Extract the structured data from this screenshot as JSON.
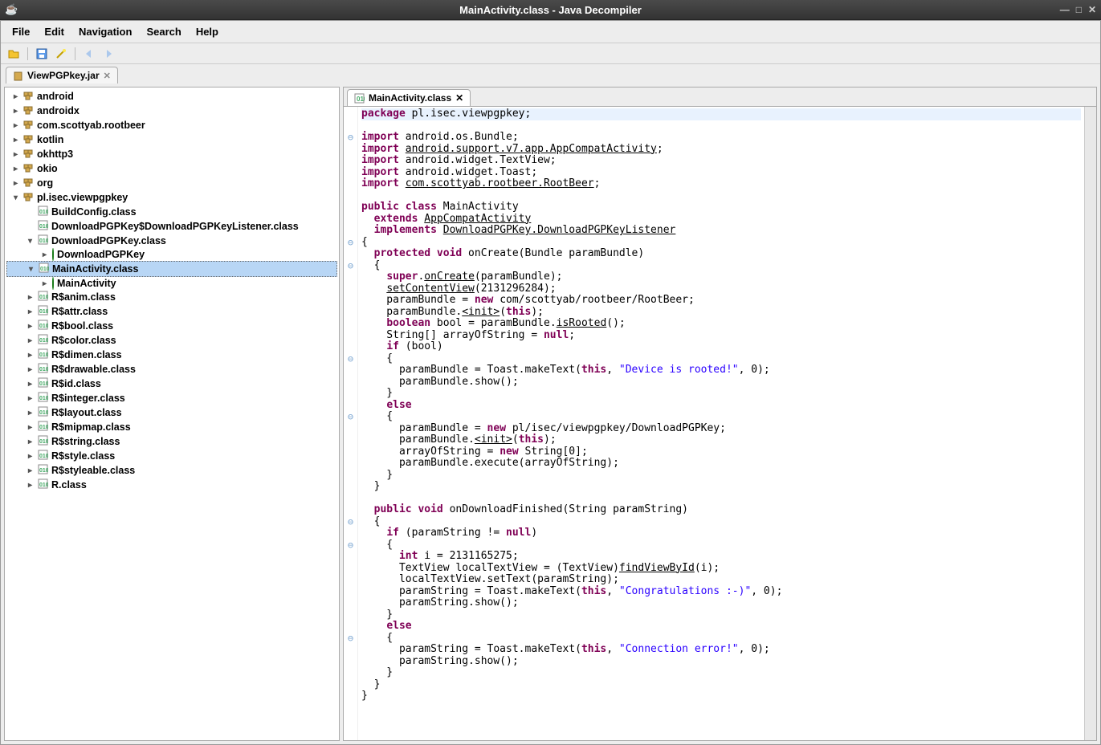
{
  "window": {
    "title": "MainActivity.class - Java Decompiler"
  },
  "menu": [
    "File",
    "Edit",
    "Navigation",
    "Search",
    "Help"
  ],
  "toolbar_icons": [
    "open-icon",
    "save-icon",
    "wand-icon",
    "back-icon",
    "forward-icon"
  ],
  "main_tab": {
    "label": "ViewPGPkey.jar"
  },
  "tree": [
    {
      "ind": 0,
      "toggle": "▸",
      "kind": "pkg",
      "label": "android"
    },
    {
      "ind": 0,
      "toggle": "▸",
      "kind": "pkg",
      "label": "androidx"
    },
    {
      "ind": 0,
      "toggle": "▸",
      "kind": "pkg",
      "label": "com.scottyab.rootbeer"
    },
    {
      "ind": 0,
      "toggle": "▸",
      "kind": "pkg",
      "label": "kotlin"
    },
    {
      "ind": 0,
      "toggle": "▸",
      "kind": "pkg",
      "label": "okhttp3"
    },
    {
      "ind": 0,
      "toggle": "▸",
      "kind": "pkg",
      "label": "okio"
    },
    {
      "ind": 0,
      "toggle": "▸",
      "kind": "pkg",
      "label": "org"
    },
    {
      "ind": 0,
      "toggle": "▾",
      "kind": "pkg",
      "label": "pl.isec.viewpgpkey"
    },
    {
      "ind": 1,
      "toggle": "",
      "kind": "cls",
      "label": "BuildConfig.class"
    },
    {
      "ind": 1,
      "toggle": "",
      "kind": "cls",
      "label": "DownloadPGPKey$DownloadPGPKeyListener.class"
    },
    {
      "ind": 1,
      "toggle": "▾",
      "kind": "cls",
      "label": "DownloadPGPKey.class"
    },
    {
      "ind": 2,
      "toggle": "▸",
      "kind": "mth",
      "label": "DownloadPGPKey"
    },
    {
      "ind": 1,
      "toggle": "▾",
      "kind": "cls",
      "label": "MainActivity.class",
      "selected": true
    },
    {
      "ind": 2,
      "toggle": "▸",
      "kind": "mth",
      "label": "MainActivity"
    },
    {
      "ind": 1,
      "toggle": "▸",
      "kind": "cls",
      "label": "R$anim.class"
    },
    {
      "ind": 1,
      "toggle": "▸",
      "kind": "cls",
      "label": "R$attr.class"
    },
    {
      "ind": 1,
      "toggle": "▸",
      "kind": "cls",
      "label": "R$bool.class"
    },
    {
      "ind": 1,
      "toggle": "▸",
      "kind": "cls",
      "label": "R$color.class"
    },
    {
      "ind": 1,
      "toggle": "▸",
      "kind": "cls",
      "label": "R$dimen.class"
    },
    {
      "ind": 1,
      "toggle": "▸",
      "kind": "cls",
      "label": "R$drawable.class"
    },
    {
      "ind": 1,
      "toggle": "▸",
      "kind": "cls",
      "label": "R$id.class"
    },
    {
      "ind": 1,
      "toggle": "▸",
      "kind": "cls",
      "label": "R$integer.class"
    },
    {
      "ind": 1,
      "toggle": "▸",
      "kind": "cls",
      "label": "R$layout.class"
    },
    {
      "ind": 1,
      "toggle": "▸",
      "kind": "cls",
      "label": "R$mipmap.class"
    },
    {
      "ind": 1,
      "toggle": "▸",
      "kind": "cls",
      "label": "R$string.class"
    },
    {
      "ind": 1,
      "toggle": "▸",
      "kind": "cls",
      "label": "R$style.class"
    },
    {
      "ind": 1,
      "toggle": "▸",
      "kind": "cls",
      "label": "R$styleable.class"
    },
    {
      "ind": 1,
      "toggle": "▸",
      "kind": "cls",
      "label": "R.class"
    }
  ],
  "editor_tab": {
    "label": "MainActivity.class"
  },
  "code_lines": [
    {
      "fold": "",
      "hl": true,
      "tokens": [
        {
          "t": "kw",
          "v": "package"
        },
        {
          "t": "",
          "v": " pl.isec.viewpgpkey;"
        }
      ]
    },
    {
      "fold": "",
      "tokens": [
        {
          "t": "",
          "v": ""
        }
      ]
    },
    {
      "fold": "⊖",
      "tokens": [
        {
          "t": "kw",
          "v": "import"
        },
        {
          "t": "",
          "v": " android.os.Bundle;"
        }
      ]
    },
    {
      "fold": "",
      "tokens": [
        {
          "t": "kw",
          "v": "import"
        },
        {
          "t": "",
          "v": " "
        },
        {
          "t": "lnk",
          "v": "android.support.v7.app.AppCompatActivity"
        },
        {
          "t": "",
          "v": ";"
        }
      ]
    },
    {
      "fold": "",
      "tokens": [
        {
          "t": "kw",
          "v": "import"
        },
        {
          "t": "",
          "v": " android.widget.TextView;"
        }
      ]
    },
    {
      "fold": "",
      "tokens": [
        {
          "t": "kw",
          "v": "import"
        },
        {
          "t": "",
          "v": " android.widget.Toast;"
        }
      ]
    },
    {
      "fold": "",
      "tokens": [
        {
          "t": "kw",
          "v": "import"
        },
        {
          "t": "",
          "v": " "
        },
        {
          "t": "lnk",
          "v": "com.scottyab.rootbeer.RootBeer"
        },
        {
          "t": "",
          "v": ";"
        }
      ]
    },
    {
      "fold": "",
      "tokens": [
        {
          "t": "",
          "v": ""
        }
      ]
    },
    {
      "fold": "",
      "tokens": [
        {
          "t": "kw",
          "v": "public class"
        },
        {
          "t": "",
          "v": " MainActivity"
        }
      ]
    },
    {
      "fold": "",
      "tokens": [
        {
          "t": "",
          "v": "  "
        },
        {
          "t": "kw",
          "v": "extends"
        },
        {
          "t": "",
          "v": " "
        },
        {
          "t": "lnk",
          "v": "AppCompatActivity"
        }
      ]
    },
    {
      "fold": "",
      "tokens": [
        {
          "t": "",
          "v": "  "
        },
        {
          "t": "kw",
          "v": "implements"
        },
        {
          "t": "",
          "v": " "
        },
        {
          "t": "lnk",
          "v": "DownloadPGPKey.DownloadPGPKeyListener"
        }
      ]
    },
    {
      "fold": "⊖",
      "tokens": [
        {
          "t": "",
          "v": "{"
        }
      ]
    },
    {
      "fold": "",
      "tokens": [
        {
          "t": "",
          "v": "  "
        },
        {
          "t": "kw",
          "v": "protected void"
        },
        {
          "t": "",
          "v": " onCreate(Bundle paramBundle)"
        }
      ]
    },
    {
      "fold": "⊖",
      "tokens": [
        {
          "t": "",
          "v": "  {"
        }
      ]
    },
    {
      "fold": "",
      "tokens": [
        {
          "t": "",
          "v": "    "
        },
        {
          "t": "kw",
          "v": "super"
        },
        {
          "t": "",
          "v": "."
        },
        {
          "t": "lnk",
          "v": "onCreate"
        },
        {
          "t": "",
          "v": "(paramBundle);"
        }
      ]
    },
    {
      "fold": "",
      "tokens": [
        {
          "t": "",
          "v": "    "
        },
        {
          "t": "lnk",
          "v": "setContentView"
        },
        {
          "t": "",
          "v": "(2131296284);"
        }
      ]
    },
    {
      "fold": "",
      "tokens": [
        {
          "t": "",
          "v": "    paramBundle = "
        },
        {
          "t": "kw",
          "v": "new"
        },
        {
          "t": "",
          "v": " com/scottyab/rootbeer/RootBeer;"
        }
      ]
    },
    {
      "fold": "",
      "tokens": [
        {
          "t": "",
          "v": "    paramBundle."
        },
        {
          "t": "lnk",
          "v": "<init>"
        },
        {
          "t": "",
          "v": "("
        },
        {
          "t": "kw",
          "v": "this"
        },
        {
          "t": "",
          "v": ");"
        }
      ]
    },
    {
      "fold": "",
      "tokens": [
        {
          "t": "",
          "v": "    "
        },
        {
          "t": "kw",
          "v": "boolean"
        },
        {
          "t": "",
          "v": " bool = paramBundle."
        },
        {
          "t": "lnk",
          "v": "isRooted"
        },
        {
          "t": "",
          "v": "();"
        }
      ]
    },
    {
      "fold": "",
      "tokens": [
        {
          "t": "",
          "v": "    String[] arrayOfString = "
        },
        {
          "t": "kw",
          "v": "null"
        },
        {
          "t": "",
          "v": ";"
        }
      ]
    },
    {
      "fold": "",
      "tokens": [
        {
          "t": "",
          "v": "    "
        },
        {
          "t": "kw",
          "v": "if"
        },
        {
          "t": "",
          "v": " (bool)"
        }
      ]
    },
    {
      "fold": "⊖",
      "tokens": [
        {
          "t": "",
          "v": "    {"
        }
      ]
    },
    {
      "fold": "",
      "tokens": [
        {
          "t": "",
          "v": "      paramBundle = Toast.makeText("
        },
        {
          "t": "kw",
          "v": "this"
        },
        {
          "t": "",
          "v": ", "
        },
        {
          "t": "str",
          "v": "\"Device is rooted!\""
        },
        {
          "t": "",
          "v": ", 0);"
        }
      ]
    },
    {
      "fold": "",
      "tokens": [
        {
          "t": "",
          "v": "      paramBundle.show();"
        }
      ]
    },
    {
      "fold": "",
      "tokens": [
        {
          "t": "",
          "v": "    }"
        }
      ]
    },
    {
      "fold": "",
      "tokens": [
        {
          "t": "",
          "v": "    "
        },
        {
          "t": "kw",
          "v": "else"
        }
      ]
    },
    {
      "fold": "⊖",
      "tokens": [
        {
          "t": "",
          "v": "    {"
        }
      ]
    },
    {
      "fold": "",
      "tokens": [
        {
          "t": "",
          "v": "      paramBundle = "
        },
        {
          "t": "kw",
          "v": "new"
        },
        {
          "t": "",
          "v": " pl/isec/viewpgpkey/DownloadPGPKey;"
        }
      ]
    },
    {
      "fold": "",
      "tokens": [
        {
          "t": "",
          "v": "      paramBundle."
        },
        {
          "t": "lnk",
          "v": "<init>"
        },
        {
          "t": "",
          "v": "("
        },
        {
          "t": "kw",
          "v": "this"
        },
        {
          "t": "",
          "v": ");"
        }
      ]
    },
    {
      "fold": "",
      "tokens": [
        {
          "t": "",
          "v": "      arrayOfString = "
        },
        {
          "t": "kw",
          "v": "new"
        },
        {
          "t": "",
          "v": " String[0];"
        }
      ]
    },
    {
      "fold": "",
      "tokens": [
        {
          "t": "",
          "v": "      paramBundle.execute(arrayOfString);"
        }
      ]
    },
    {
      "fold": "",
      "tokens": [
        {
          "t": "",
          "v": "    }"
        }
      ]
    },
    {
      "fold": "",
      "tokens": [
        {
          "t": "",
          "v": "  }"
        }
      ]
    },
    {
      "fold": "",
      "tokens": [
        {
          "t": "",
          "v": "  "
        }
      ]
    },
    {
      "fold": "",
      "tokens": [
        {
          "t": "",
          "v": "  "
        },
        {
          "t": "kw",
          "v": "public void"
        },
        {
          "t": "",
          "v": " onDownloadFinished(String paramString)"
        }
      ]
    },
    {
      "fold": "⊖",
      "tokens": [
        {
          "t": "",
          "v": "  {"
        }
      ]
    },
    {
      "fold": "",
      "tokens": [
        {
          "t": "",
          "v": "    "
        },
        {
          "t": "kw",
          "v": "if"
        },
        {
          "t": "",
          "v": " (paramString != "
        },
        {
          "t": "kw",
          "v": "null"
        },
        {
          "t": "",
          "v": ")"
        }
      ]
    },
    {
      "fold": "⊖",
      "tokens": [
        {
          "t": "",
          "v": "    {"
        }
      ]
    },
    {
      "fold": "",
      "tokens": [
        {
          "t": "",
          "v": "      "
        },
        {
          "t": "kw",
          "v": "int"
        },
        {
          "t": "",
          "v": " i = 2131165275;"
        }
      ]
    },
    {
      "fold": "",
      "tokens": [
        {
          "t": "",
          "v": "      TextView localTextView = (TextView)"
        },
        {
          "t": "lnk",
          "v": "findViewById"
        },
        {
          "t": "",
          "v": "(i);"
        }
      ]
    },
    {
      "fold": "",
      "tokens": [
        {
          "t": "",
          "v": "      localTextView.setText(paramString);"
        }
      ]
    },
    {
      "fold": "",
      "tokens": [
        {
          "t": "",
          "v": "      paramString = Toast.makeText("
        },
        {
          "t": "kw",
          "v": "this"
        },
        {
          "t": "",
          "v": ", "
        },
        {
          "t": "str",
          "v": "\"Congratulations :-)\""
        },
        {
          "t": "",
          "v": ", 0);"
        }
      ]
    },
    {
      "fold": "",
      "tokens": [
        {
          "t": "",
          "v": "      paramString.show();"
        }
      ]
    },
    {
      "fold": "",
      "tokens": [
        {
          "t": "",
          "v": "    }"
        }
      ]
    },
    {
      "fold": "",
      "tokens": [
        {
          "t": "",
          "v": "    "
        },
        {
          "t": "kw",
          "v": "else"
        }
      ]
    },
    {
      "fold": "⊖",
      "tokens": [
        {
          "t": "",
          "v": "    {"
        }
      ]
    },
    {
      "fold": "",
      "tokens": [
        {
          "t": "",
          "v": "      paramString = Toast.makeText("
        },
        {
          "t": "kw",
          "v": "this"
        },
        {
          "t": "",
          "v": ", "
        },
        {
          "t": "str",
          "v": "\"Connection error!\""
        },
        {
          "t": "",
          "v": ", 0);"
        }
      ]
    },
    {
      "fold": "",
      "tokens": [
        {
          "t": "",
          "v": "      paramString.show();"
        }
      ]
    },
    {
      "fold": "",
      "tokens": [
        {
          "t": "",
          "v": "    }"
        }
      ]
    },
    {
      "fold": "",
      "tokens": [
        {
          "t": "",
          "v": "  }"
        }
      ]
    },
    {
      "fold": "",
      "tokens": [
        {
          "t": "",
          "v": "}"
        }
      ]
    }
  ]
}
